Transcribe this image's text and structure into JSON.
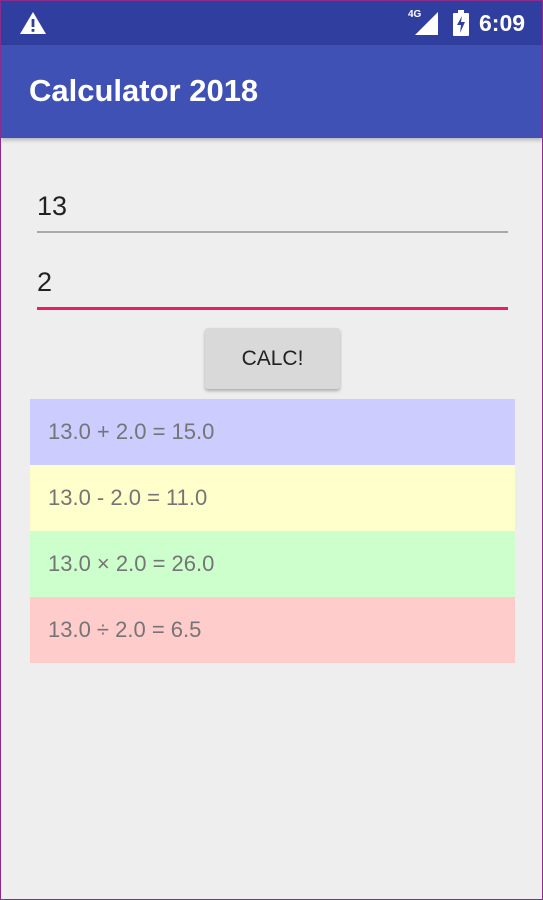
{
  "status_bar": {
    "warning_icon": "warning-icon",
    "network_label": "4G",
    "signal_icon": "signal-icon",
    "battery_icon": "battery-charging-icon",
    "time": "6:09",
    "background": "#303f9f"
  },
  "app_bar": {
    "title": "Calculator 2018",
    "background": "#3f51b5"
  },
  "inputs": {
    "first_value": "13",
    "second_value": "2",
    "focused_underline_color": "#e91e63"
  },
  "button": {
    "label": "CALC!"
  },
  "results": [
    {
      "text": "13.0 + 2.0 = 15.0",
      "background": "#ccccff"
    },
    {
      "text": "13.0 - 2.0 = 11.0",
      "background": "#ffffcc"
    },
    {
      "text": "13.0 × 2.0 = 26.0",
      "background": "#ccffcc"
    },
    {
      "text": "13.0 ÷ 2.0 = 6.5",
      "background": "#ffcccc"
    }
  ]
}
